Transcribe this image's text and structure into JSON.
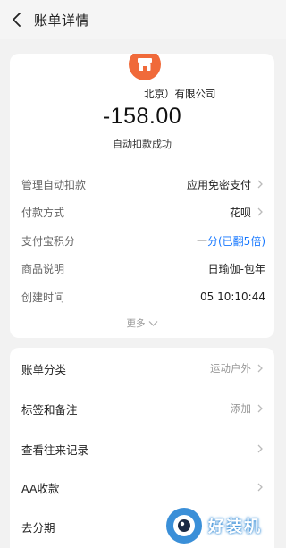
{
  "header": {
    "title": "账单详情"
  },
  "merchant": {
    "name": "北京）有限公司",
    "amount": "-158.00",
    "status": "自动扣款成功"
  },
  "details": [
    {
      "label": "管理自动扣款",
      "value": "应用免密支付",
      "chevron": true
    },
    {
      "label": "付款方式",
      "value": "花呗",
      "chevron": true
    },
    {
      "label": "支付宝积分",
      "value": "分(已翻5倍)",
      "chevron": false
    },
    {
      "label": "商品说明",
      "value": "日瑜伽-包年",
      "chevron": false
    },
    {
      "label": "创建时间",
      "value": "05 10:10:44",
      "chevron": false
    }
  ],
  "more_label": "更多",
  "actions": [
    {
      "label": "账单分类",
      "value": "运动户外"
    },
    {
      "label": "标签和备注",
      "value": "添加"
    },
    {
      "label": "查看往来记录",
      "value": ""
    },
    {
      "label": "AA收款",
      "value": ""
    },
    {
      "label": "去分期",
      "value": ""
    }
  ],
  "watermark": {
    "text": "好装机"
  },
  "colors": {
    "accent_blue": "#1677ff",
    "logo_orange": "#f06a3a",
    "background": "#f2f2f2"
  }
}
